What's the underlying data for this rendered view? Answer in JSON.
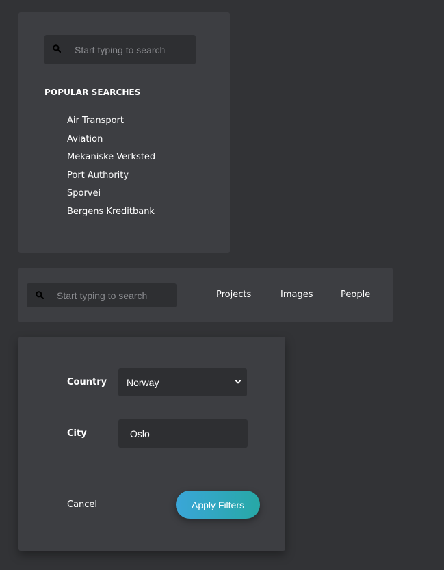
{
  "popular_panel": {
    "search": {
      "placeholder": "Start typing to search",
      "value": ""
    },
    "heading": "POPULAR SEARCHES",
    "items": [
      {
        "label": "Air Transport"
      },
      {
        "label": "Aviation"
      },
      {
        "label": "Mekaniske Verksted"
      },
      {
        "label": "Port Authority"
      },
      {
        "label": "Sporvei"
      },
      {
        "label": "Bergens Kreditbank"
      }
    ]
  },
  "nav_panel": {
    "search": {
      "placeholder": "Start typing to search",
      "value": ""
    },
    "links": {
      "projects": "Projects",
      "images": "Images",
      "people": "People"
    }
  },
  "filters_panel": {
    "country": {
      "label": "Country",
      "selected": "Norway"
    },
    "city": {
      "label": "City",
      "value": "Oslo"
    },
    "cancel_label": "Cancel",
    "apply_label": "Apply Filters"
  },
  "icons": {
    "search": "search-icon",
    "dropdown": "chevron-down-icon"
  },
  "colors": {
    "background": "#323336",
    "panel": "#3d3e42",
    "field": "#2e2f32",
    "accent_start": "#3aa6d8",
    "accent_end": "#27a8a6"
  }
}
